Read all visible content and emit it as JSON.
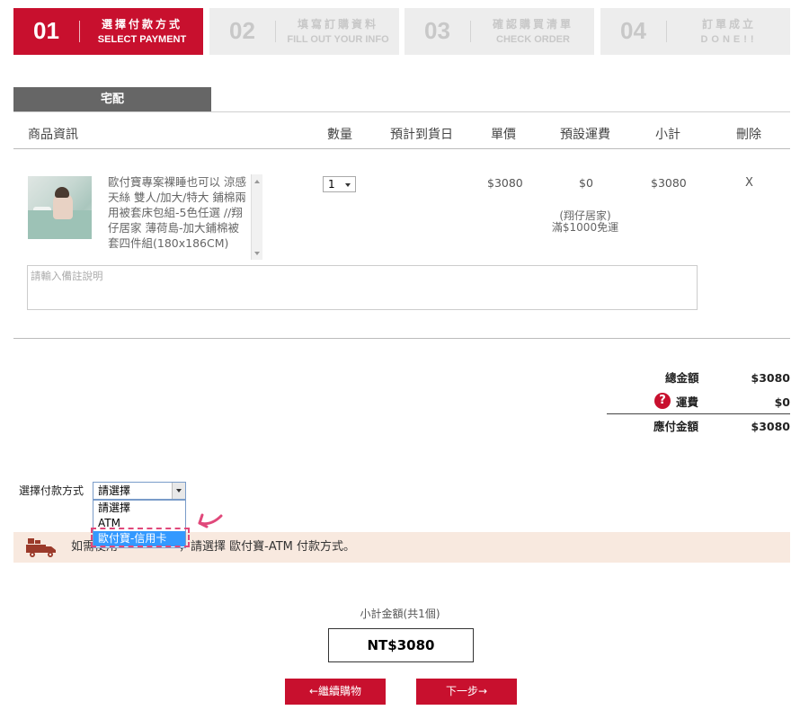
{
  "steps": [
    {
      "num": "01",
      "zh": "選擇付款方式",
      "en": "SELECT PAYMENT"
    },
    {
      "num": "02",
      "zh": "填寫訂購資料",
      "en": "FILL OUT YOUR INFO"
    },
    {
      "num": "03",
      "zh": "確認購買清單",
      "en": "CHECK ORDER"
    },
    {
      "num": "04",
      "zh": "訂單成立",
      "en": "DONE!!"
    }
  ],
  "delivery_tab": "宅配",
  "table_headers": {
    "product": "商品資訊",
    "qty": "數量",
    "delivery_date": "預計到貨日",
    "unit_price": "單價",
    "shipping": "預設運費",
    "subtotal": "小計",
    "delete": "刪除"
  },
  "product": {
    "image_icon": "product-photo-bedding",
    "description": "歐付寶專案裸睡也可以 涼感天絲 雙人/加大/特大 鋪棉兩用被套床包組-5色任選 //翔仔居家 薄荷島-加大鋪棉被套四件組(180x186CM)",
    "qty": "1",
    "unit_price": "$3080",
    "shipping": "$0",
    "shipping_note_1": "(翔仔居家)",
    "shipping_note_2": "滿$1000免運",
    "subtotal": "$3080",
    "delete": "X"
  },
  "remark_placeholder": "請輸入備註說明",
  "totals": {
    "total_label": "總金額",
    "total_value": "$3080",
    "shipping_label": "運費",
    "shipping_value": "$0",
    "payable_label": "應付金額",
    "payable_value": "$3080",
    "help_icon_text": "?"
  },
  "payment": {
    "label": "選擇付款方式",
    "selected": "請選擇",
    "options": [
      "請選擇",
      "ATM",
      "歐付寶-信用卡"
    ],
    "highlighted_index": 2
  },
  "notice": {
    "prefix": "如需使用",
    "suffix": "，請選擇 歐付寶-ATM 付款方式。",
    "icon": "delivery-truck-icon"
  },
  "summary": {
    "label": "小計金額(共1個)",
    "amount": "NT$3080"
  },
  "buttons": {
    "continue_shopping": "←繼續購物",
    "next_step": "下一步→"
  },
  "colors": {
    "brand_red": "#c8102e",
    "tab_gray": "#666666",
    "notice_bg": "#f8e9df",
    "highlight_pink": "#e0487a",
    "select_blue": "#3399ff"
  }
}
